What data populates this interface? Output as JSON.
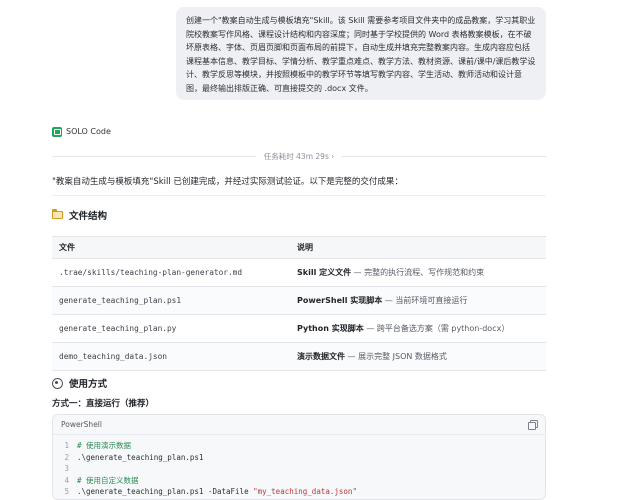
{
  "user_message": {
    "text": "创建一个\"教案自动生成与模板填充\"Skill。该 Skill 需要参考项目文件夹中的成品教案，学习其职业院校教案写作风格、课程设计结构和内容深度；同时基于学校提供的 Word 表格教案模板，在不破坏原表格、字体、页眉页脚和页面布局的前提下，自动生成并填充完整教案内容。生成内容应包括课程基本信息、教学目标、学情分析、教学重点难点、教学方法、教材资源、课前/课中/课后教学设计、教学反思等模块，并按照模板中的教学环节等填写教学内容、学生活动、教师活动和设计意图，最终输出排版正确、可直接提交的 .docx 文件。"
  },
  "assistant": {
    "name": "SOLO Code",
    "duration_label": "任务耗时 43m 29s ›",
    "intro": "\"教案自动生成与模板填充\"Skill 已创建完成，并经过实际测试验证。以下是完整的交付成果：",
    "file_section_title": "文件结构",
    "table": {
      "headers": [
        "文件",
        "说明"
      ],
      "rows": [
        {
          "file": ".trae/skills/teaching-plan-generator.md",
          "desc_bold": "Skill 定义文件",
          "desc_rest": " — 完整的执行流程、写作规范和约束"
        },
        {
          "file": "generate_teaching_plan.ps1",
          "desc_bold": "PowerShell 实现脚本",
          "desc_rest": " — 当前环境可直接运行"
        },
        {
          "file": "generate_teaching_plan.py",
          "desc_bold": "Python 实现脚本",
          "desc_rest": " — 跨平台备选方案（需 python-docx）"
        },
        {
          "file": "demo_teaching_data.json",
          "desc_bold": "演示数据文件",
          "desc_rest": " — 展示完整 JSON 数据格式"
        }
      ]
    },
    "usage_section_title": "使用方式",
    "method_title": "方式一：直接运行（推荐）",
    "code": {
      "language": "PowerShell",
      "lines": [
        {
          "n": "1",
          "text": "# 使用演示数据",
          "kind": "comment"
        },
        {
          "n": "2",
          "text": ".\\generate_teaching_plan.ps1",
          "kind": "code"
        },
        {
          "n": "3",
          "text": "",
          "kind": "code"
        },
        {
          "n": "4",
          "text": "# 使用自定义数据",
          "kind": "comment"
        },
        {
          "n": "5",
          "text": ".\\generate_teaching_plan.ps1 -DataFile ",
          "kind": "code",
          "string": "\"my_teaching_data.json\""
        }
      ]
    }
  },
  "icons": {
    "solo_logo": "solo-logo-icon",
    "folder": "folder-icon",
    "gear": "gear-icon",
    "copy": "copy-icon"
  },
  "colors": {
    "user_bubble_bg": "#eef0f3",
    "solo_green": "#22a55a",
    "comment_green": "#2e8b57",
    "string_red": "#b33a3a"
  }
}
